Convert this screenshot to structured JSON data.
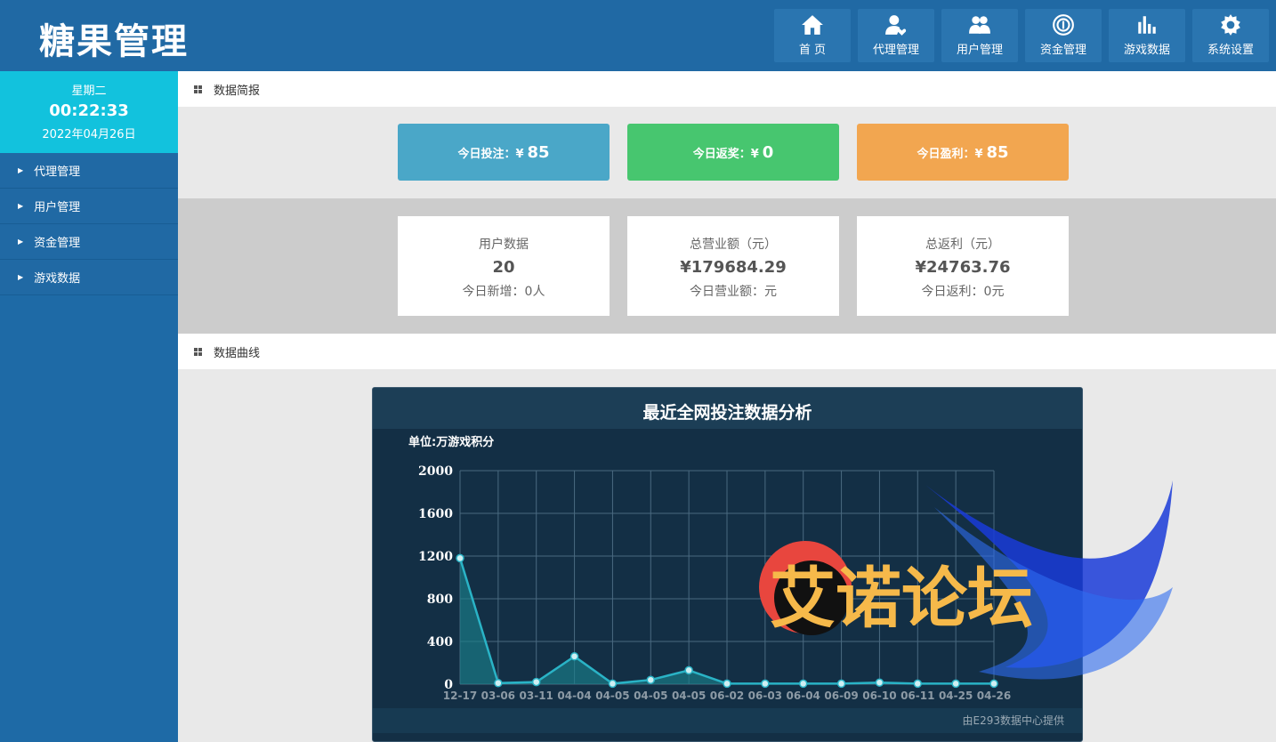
{
  "header": {
    "logo": "糖果管理",
    "nav": [
      {
        "label": "首 页",
        "icon": "home-icon"
      },
      {
        "label": "代理管理",
        "icon": "user-heart-icon"
      },
      {
        "label": "用户管理",
        "icon": "users-icon"
      },
      {
        "label": "资金管理",
        "icon": "coin-icon"
      },
      {
        "label": "游戏数据",
        "icon": "bar-chart-icon"
      },
      {
        "label": "系统设置",
        "icon": "gear-icon"
      }
    ]
  },
  "sidebar": {
    "clock": {
      "weekday": "星期二",
      "time": "00:22:33",
      "date": "2022年04月26日"
    },
    "items": [
      {
        "label": "代理管理"
      },
      {
        "label": "用户管理"
      },
      {
        "label": "资金管理"
      },
      {
        "label": "游戏数据"
      }
    ]
  },
  "main": {
    "briefing_title": "数据简报",
    "stats": [
      {
        "label": "今日投注：¥",
        "value": "85"
      },
      {
        "label": "今日返奖：¥",
        "value": "0"
      },
      {
        "label": "今日盈利：¥",
        "value": "85"
      }
    ],
    "cards": [
      {
        "title": "用户数据",
        "value": "20",
        "sub": "今日新增：0人"
      },
      {
        "title": "总营业额（元）",
        "value": "¥179684.29",
        "sub": "今日营业额：元"
      },
      {
        "title": "总返利（元）",
        "value": "¥24763.76",
        "sub": "今日返利：0元"
      }
    ],
    "curve_title": "数据曲线"
  },
  "chart": {
    "title": "最近全网投注数据分析",
    "unit": "单位:万游戏积分",
    "footer": "由E293数据中心提供",
    "watermark": "艾诺论坛",
    "colors": {
      "line": "#2ab3c6",
      "area": "#1a7f8a",
      "point_fill": "#cfeff3",
      "grid": "#4a6a80",
      "bg": "#132f45"
    }
  },
  "chart_data": {
    "type": "area",
    "categories": [
      "12-17",
      "03-06",
      "03-11",
      "04-04",
      "04-05",
      "04-05",
      "04-05",
      "06-02",
      "06-03",
      "06-04",
      "06-09",
      "06-10",
      "06-11",
      "04-25",
      "04-26"
    ],
    "values": [
      1180,
      10,
      20,
      260,
      5,
      40,
      130,
      5,
      5,
      5,
      5,
      15,
      5,
      5,
      5
    ],
    "ylim": [
      0,
      2000
    ],
    "yticks": [
      "0",
      "400",
      "800",
      "1200",
      "1600",
      "2000"
    ],
    "grid": true
  }
}
